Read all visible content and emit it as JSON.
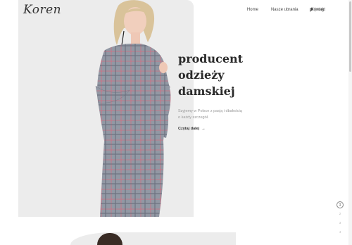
{
  "brand": {
    "logo_text": "Koren"
  },
  "nav": {
    "items": [
      {
        "label": "Home"
      },
      {
        "label": "Nasze ubrania"
      },
      {
        "label": "Kontakt"
      }
    ]
  },
  "lang": {
    "active": "pl",
    "separator": "|",
    "other": "eng"
  },
  "hero": {
    "headline_lines": [
      "producent",
      "odzieży",
      "damskiej"
    ],
    "subtext": "Szyjemy w Polsce z pasją i dbałością o każdy szczegół.",
    "read_more": "Czytaj dalej",
    "read_more_arrow": "→"
  },
  "pager": {
    "items": [
      {
        "label": "1"
      },
      {
        "label": "2"
      },
      {
        "label": "3"
      },
      {
        "label": "4"
      }
    ],
    "active_index": 0
  },
  "colors": {
    "hero_bg": "#ececec",
    "text_dark": "#2a2a2a",
    "text_muted": "#999999",
    "dress_base": "#8a8f9c",
    "dress_check": "#d86a7e"
  }
}
